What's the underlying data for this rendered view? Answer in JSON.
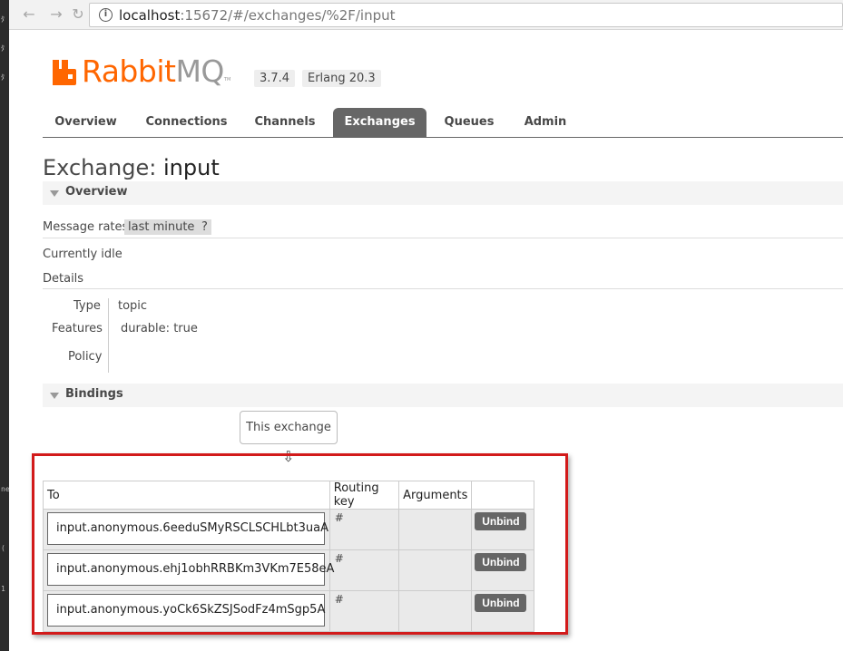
{
  "browser": {
    "url_host": "localhost",
    "url_rest": ":15672/#/exchanges/%2F/input",
    "back_icon": "back-arrow-icon",
    "forward_icon": "forward-arrow-icon",
    "reload_icon": "reload-icon"
  },
  "header": {
    "logo_r": "Rabbit",
    "logo_mq": "MQ",
    "logo_tm": "TM",
    "version": "3.7.4",
    "erlang": "Erlang 20.3",
    "brand_color": "#ff6600"
  },
  "tabs": [
    {
      "label": "Overview"
    },
    {
      "label": "Connections"
    },
    {
      "label": "Channels"
    },
    {
      "label": "Exchanges"
    },
    {
      "label": "Queues"
    },
    {
      "label": "Admin"
    }
  ],
  "page": {
    "title_prefix": "Exchange:",
    "title_name": "input"
  },
  "overview": {
    "heading": "Overview",
    "message_rates_label": "Message rates",
    "rates_period": "last minute",
    "help": "?",
    "status": "Currently idle",
    "details_label": "Details",
    "type_label": "Type",
    "type_value": "topic",
    "features_label": "Features",
    "feature_key": "durable:",
    "feature_value": "true",
    "policy_label": "Policy"
  },
  "bindings": {
    "heading": "Bindings",
    "this_exchange": "This exchange",
    "arrow": "⇩",
    "columns": [
      "To",
      "Routing key",
      "Arguments"
    ],
    "rows": [
      {
        "to": "input.anonymous.6eeduSMyRSCLSCHLbt3uaA",
        "routing_key": "#",
        "arguments": "",
        "action": "Unbind"
      },
      {
        "to": "input.anonymous.ehj1obhRRBKm3VKm7E58eA",
        "routing_key": "#",
        "arguments": "",
        "action": "Unbind"
      },
      {
        "to": "input.anonymous.yoCk6SkZSJSodFz4mSgp5A",
        "routing_key": "#",
        "arguments": "",
        "action": "Unbind"
      }
    ]
  }
}
